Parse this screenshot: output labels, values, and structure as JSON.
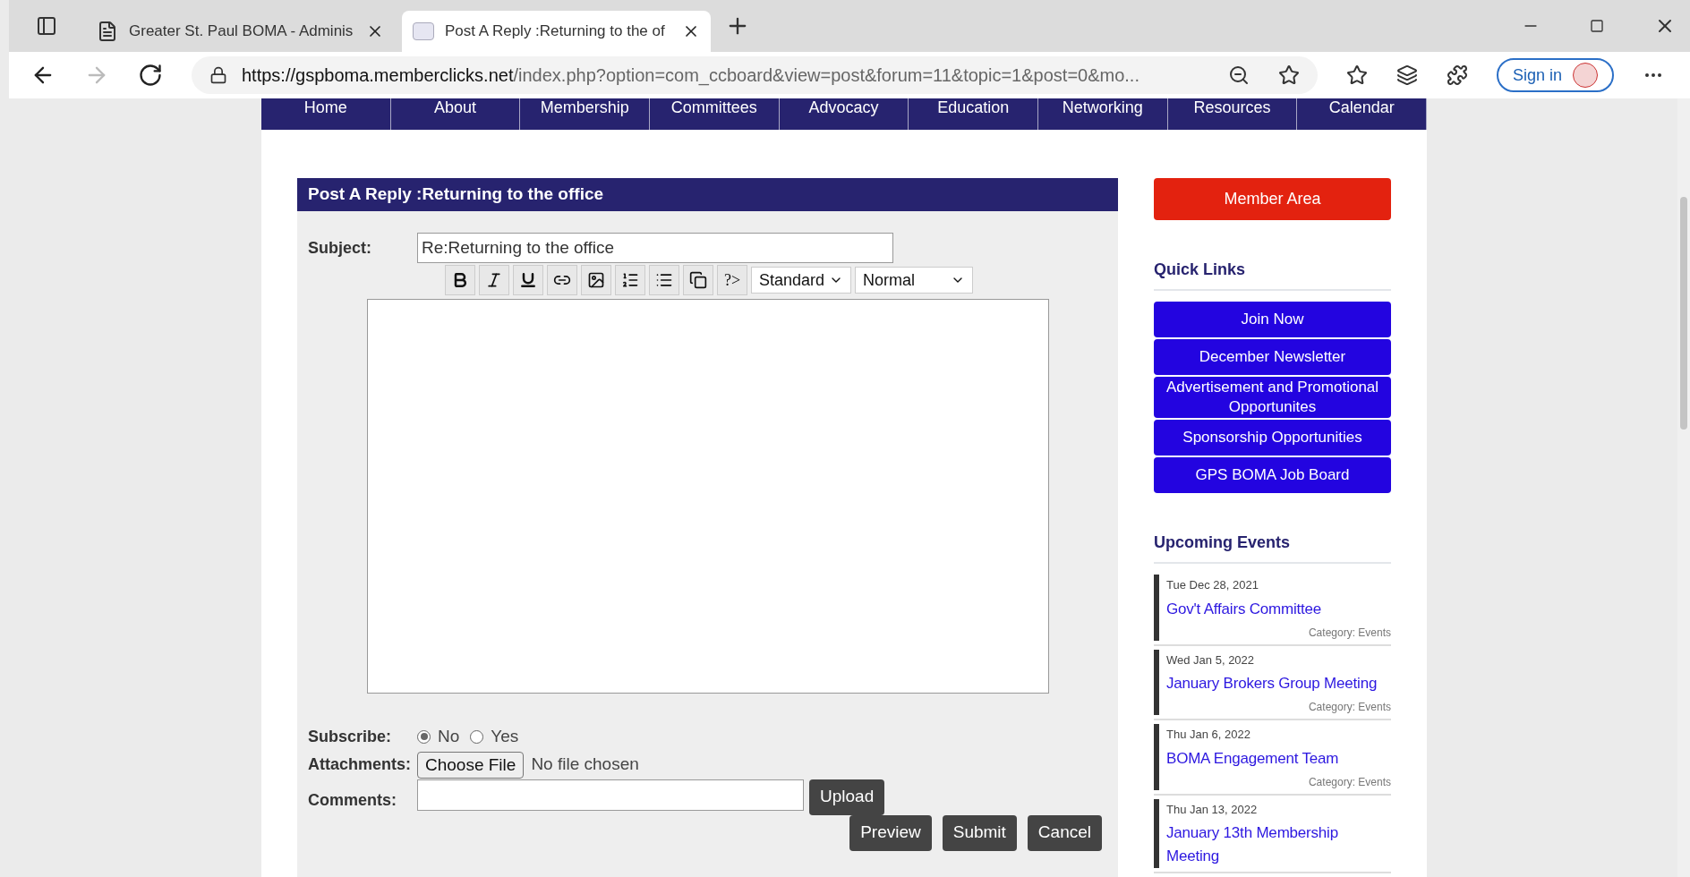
{
  "browser": {
    "tabs": [
      {
        "title": "Greater St. Paul BOMA - Adminis",
        "selected": false
      },
      {
        "title": "Post A Reply :Returning to the of",
        "selected": true
      }
    ],
    "address": {
      "domain": "https://gspboma.memberclicks.net",
      "path": "/index.php?option=com_ccboard&view=post&forum=11&topic=1&post=0&mo..."
    },
    "sign_in": "Sign in"
  },
  "nav": [
    "Home",
    "About",
    "Membership",
    "Committees",
    "Advocacy",
    "Education",
    "Networking",
    "Resources",
    "Calendar"
  ],
  "form": {
    "title": "Post A Reply :Returning to the office",
    "subject": {
      "label": "Subject:",
      "value": "Re:Returning to the office"
    },
    "toolbar": [
      {
        "kind": "bold"
      },
      {
        "kind": "italic"
      },
      {
        "kind": "underline"
      },
      {
        "kind": "link"
      },
      {
        "kind": "image"
      },
      {
        "kind": "ordered"
      },
      {
        "kind": "bullets"
      },
      {
        "kind": "copy"
      },
      {
        "kind": "text",
        "label": "?>"
      }
    ],
    "selects": [
      "Standard",
      "Normal"
    ],
    "subscribe": {
      "label": "Subscribe:",
      "options": [
        {
          "label": "No",
          "selected": true
        },
        {
          "label": "Yes",
          "selected": false
        }
      ]
    },
    "attachments": {
      "label": "Attachments:",
      "button": "Choose File",
      "status": "No file chosen"
    },
    "comments": {
      "label": "Comments:",
      "upload": "Upload"
    },
    "actions": [
      "Preview",
      "Submit",
      "Cancel"
    ]
  },
  "sidebar": {
    "member_area": "Member Area",
    "quick_links_title": "Quick Links",
    "quick_links": [
      "Join Now",
      "December Newsletter",
      "Advertisement and Promotional Opportunites",
      "Sponsorship Opportunities",
      "GPS BOMA Job Board"
    ],
    "events_title": "Upcoming Events",
    "events": [
      {
        "date": "Tue Dec 28, 2021",
        "title": "Gov't Affairs Committee",
        "category": "Category: Events"
      },
      {
        "date": "Wed Jan 5, 2022",
        "title": "January Brokers Group Meeting",
        "category": "Category: Events"
      },
      {
        "date": "Thu Jan 6, 2022",
        "title": "BOMA Engagement Team",
        "category": "Category: Events"
      },
      {
        "date": "Thu Jan 13, 2022",
        "title": "January 13th Membership Meeting"
      }
    ]
  }
}
